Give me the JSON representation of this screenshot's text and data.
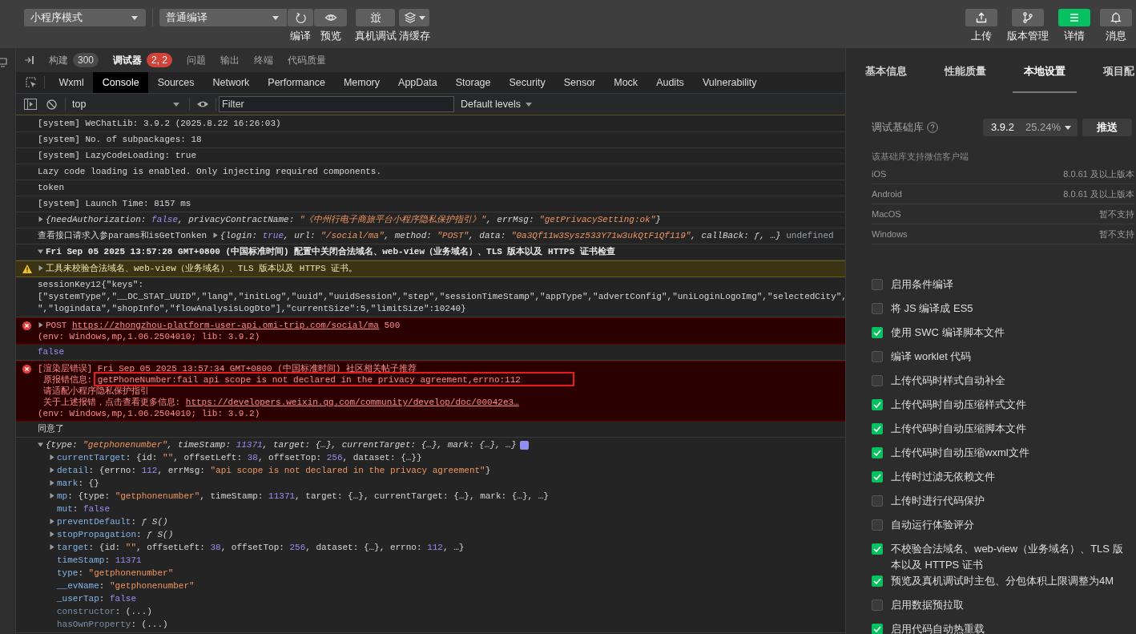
{
  "toolbar": {
    "mode_select": "小程序模式",
    "compile_select": "普通编译",
    "tools": [
      {
        "label": "编译"
      },
      {
        "label": "预览"
      },
      {
        "label": "真机调试"
      },
      {
        "label": "清缓存"
      }
    ],
    "actions": [
      {
        "label": "上传",
        "selected": false
      },
      {
        "label": "版本管理",
        "selected": false
      },
      {
        "label": "详情",
        "selected": true
      },
      {
        "label": "消息",
        "selected": false
      }
    ]
  },
  "panel_tabs": [
    {
      "label": "构建",
      "badge": "300",
      "color": "#4a4a4a",
      "selected": false
    },
    {
      "label": "调试器",
      "badge": "2, 2",
      "color": "#d0423a",
      "selected": true
    },
    {
      "label": "问题",
      "selected": false
    },
    {
      "label": "输出",
      "selected": false
    },
    {
      "label": "终端",
      "selected": false
    },
    {
      "label": "代码质量",
      "selected": false
    }
  ],
  "devtools_tabs": [
    {
      "label": "Wxml",
      "selected": false
    },
    {
      "label": "Console",
      "selected": true
    },
    {
      "label": "Sources",
      "selected": false
    },
    {
      "label": "Network",
      "selected": false
    },
    {
      "label": "Performance",
      "selected": false
    },
    {
      "label": "Memory",
      "selected": false
    },
    {
      "label": "AppData",
      "selected": false
    },
    {
      "label": "Storage",
      "selected": false
    },
    {
      "label": "Security",
      "selected": false
    },
    {
      "label": "Sensor",
      "selected": false
    },
    {
      "label": "Mock",
      "selected": false
    },
    {
      "label": "Audits",
      "selected": false
    },
    {
      "label": "Vulnerability",
      "selected": false
    }
  ],
  "console_toolbar": {
    "context": "top",
    "filter_placeholder": "Filter",
    "levels": "Default levels"
  },
  "console": [
    {
      "kind": "info",
      "lines": [
        [
          {
            "kind": "plain",
            "text": "[system] WeChatLib: 3.9.2 (2025.8.22 16:26:03)"
          }
        ]
      ]
    },
    {
      "kind": "info",
      "lines": [
        [
          {
            "kind": "plain",
            "text": "[system] No. of subpackages: 18"
          }
        ]
      ]
    },
    {
      "kind": "info",
      "lines": [
        [
          {
            "kind": "plain",
            "text": "[system] LazyCodeLoading: true"
          }
        ]
      ]
    },
    {
      "kind": "info",
      "lines": [
        [
          {
            "kind": "plain",
            "text": "Lazy code loading is enabled. Only injecting required components."
          }
        ]
      ]
    },
    {
      "kind": "info",
      "lines": [
        [
          {
            "kind": "plain",
            "text": "token"
          }
        ]
      ]
    },
    {
      "kind": "info",
      "lines": [
        [
          {
            "kind": "plain",
            "text": "[system] Launch Time: 8157 ms"
          }
        ]
      ]
    },
    {
      "kind": "info",
      "lines": [
        [
          {
            "kind": "toggle",
            "expanded": false
          },
          {
            "kind": "preview",
            "text": "{needAuthorization: "
          },
          {
            "kind": "preview_keyword",
            "text": "false"
          },
          {
            "kind": "preview",
            "text": ", privacyContractName: "
          },
          {
            "kind": "preview_string",
            "text": "\"《中州行电子商旅平台小程序隐私保护指引》\""
          },
          {
            "kind": "preview",
            "text": ", errMsg: "
          },
          {
            "kind": "preview_string",
            "text": "\"getPrivacySetting:ok\""
          },
          {
            "kind": "preview",
            "text": "}"
          }
        ]
      ]
    },
    {
      "kind": "info",
      "lines": [
        [
          {
            "kind": "plain",
            "text": "查看接口请求入参params和isGetTonken "
          },
          {
            "kind": "toggle",
            "expanded": false
          },
          {
            "kind": "preview",
            "text": "{login: "
          },
          {
            "kind": "preview_keyword",
            "text": "true"
          },
          {
            "kind": "preview",
            "text": ", url: "
          },
          {
            "kind": "preview_string",
            "text": "\"/social/ma\""
          },
          {
            "kind": "preview",
            "text": ", method: "
          },
          {
            "kind": "preview_string",
            "text": "\"POST\""
          },
          {
            "kind": "preview",
            "text": ", data: "
          },
          {
            "kind": "preview_string",
            "text": "\"0a3Qf11w3Sysz533Y71w3ukQtF1Qf119\""
          },
          {
            "kind": "preview",
            "text": ", callBack: ƒ, …}"
          },
          {
            "kind": "muted",
            "text": " undefined"
          }
        ]
      ]
    },
    {
      "kind": "group",
      "lines": [
        [
          {
            "kind": "toggle",
            "expanded": true
          },
          {
            "kind": "plain",
            "text": "Fri Sep 05 2025 13:57:28 GMT+0800 (中国标准时间) 配置中关闭合法域名、web-view（业务域名）、TLS 版本以及 HTTPS 证书检查"
          }
        ]
      ]
    },
    {
      "kind": "warning",
      "lines": [
        [
          {
            "kind": "toggle",
            "expanded": false
          },
          {
            "kind": "plain",
            "text": "工具未校验合法域名、web-view（业务域名）、TLS 版本以及 HTTPS 证书。"
          }
        ]
      ]
    },
    {
      "kind": "info",
      "lines": [
        [
          {
            "kind": "plain",
            "text": "sessionKey12{\"keys\":"
          }
        ],
        [
          {
            "kind": "plain",
            "text": "[\"systemType\",\"__DC_STAT_UUID\",\"lang\",\"initLog\",\"uuid\",\"uuidSession\",\"step\",\"sessionTimeStamp\",\"appType\",\"advertConfig\",\"uniLoginLogoImg\",\"selectedCity\","
          }
        ],
        [
          {
            "kind": "plain",
            "text": "\",\"logindata\",\"shopInfo\",\"flowAnalysisLogDto\"],\"currentSize\":5,\"limitSize\":10240}"
          }
        ]
      ]
    },
    {
      "kind": "error",
      "lines": [
        [
          {
            "kind": "toggle",
            "expanded": false
          },
          {
            "kind": "plain",
            "text": "POST "
          },
          {
            "kind": "link",
            "text": "https://zhongzhou-platform-user-api.omi-trip.com/social/ma"
          },
          {
            "kind": "plain",
            "text": " 500"
          }
        ],
        [
          {
            "kind": "plain",
            "text": "(env: Windows,mp,1.06.2504010; lib: 3.9.2)"
          }
        ]
      ]
    },
    {
      "kind": "info",
      "lines": [
        [
          {
            "kind": "keyword",
            "text": "false"
          }
        ]
      ]
    },
    {
      "kind": "error",
      "lines": [
        [
          {
            "kind": "plain",
            "text": "[渲染层错误] Fri Sep 05 2025 13:57:34 GMT+0800 (中国标准时间) 社区相关帖子推荐"
          }
        ],
        [
          {
            "kind": "plain",
            "text": " 原报错信息: "
          },
          {
            "kind": "annotated",
            "text": "getPhoneNumber:fail api scope is not declared in the privacy agreement,errno:112"
          }
        ],
        [
          {
            "kind": "plain",
            "text": " 请适配小程序隐私保护指引"
          }
        ],
        [
          {
            "kind": "plain",
            "text": " 关于上述报错，点击查看更多信息: "
          },
          {
            "kind": "link",
            "text": "https://developers.weixin.qq.com/community/develop/doc/00042e3…"
          }
        ],
        [
          {
            "kind": "plain",
            "text": "(env: Windows,mp,1.06.2504010; lib: 3.9.2)"
          }
        ]
      ]
    },
    {
      "kind": "info",
      "lines": [
        [
          {
            "kind": "plain",
            "text": "同意了"
          }
        ]
      ]
    },
    {
      "kind": "info",
      "lines": [
        [
          {
            "kind": "toggle",
            "expanded": true
          },
          {
            "kind": "preview",
            "text": "{type: "
          },
          {
            "kind": "preview_string",
            "text": "\"getphonenumber\""
          },
          {
            "kind": "preview",
            "text": ", timeStamp: "
          },
          {
            "kind": "preview_number",
            "text": "11371"
          },
          {
            "kind": "preview",
            "text": ", target: {…}, currentTarget: {…}, mark: {…}, …}"
          },
          {
            "kind": "info_badge"
          }
        ]
      ],
      "children": [
        {
          "parts": [
            {
              "kind": "toggle",
              "expanded": false
            },
            {
              "kind": "key",
              "text": "currentTarget"
            },
            {
              "kind": "plain",
              "text": ": {id: "
            },
            {
              "kind": "string",
              "text": "\"\""
            },
            {
              "kind": "plain",
              "text": ", offsetLeft: "
            },
            {
              "kind": "number",
              "text": "38"
            },
            {
              "kind": "plain",
              "text": ", offsetTop: "
            },
            {
              "kind": "number",
              "text": "256"
            },
            {
              "kind": "plain",
              "text": ", dataset: {…}}"
            }
          ]
        },
        {
          "parts": [
            {
              "kind": "toggle",
              "expanded": false
            },
            {
              "kind": "key",
              "text": "detail"
            },
            {
              "kind": "plain",
              "text": ": {errno: "
            },
            {
              "kind": "number",
              "text": "112"
            },
            {
              "kind": "plain",
              "text": ", errMsg: "
            },
            {
              "kind": "string",
              "text": "\"api scope is not declared in the privacy agreement\""
            },
            {
              "kind": "plain",
              "text": "}"
            }
          ]
        },
        {
          "parts": [
            {
              "kind": "toggle",
              "expanded": false
            },
            {
              "kind": "key",
              "text": "mark"
            },
            {
              "kind": "plain",
              "text": ": {}"
            }
          ]
        },
        {
          "parts": [
            {
              "kind": "toggle",
              "expanded": false
            },
            {
              "kind": "key",
              "text": "mp"
            },
            {
              "kind": "plain",
              "text": ": {type: "
            },
            {
              "kind": "string",
              "text": "\"getphonenumber\""
            },
            {
              "kind": "plain",
              "text": ", timeStamp: "
            },
            {
              "kind": "number",
              "text": "11371"
            },
            {
              "kind": "plain",
              "text": ", target: {…}, currentTarget: {…}, mark: {…}, …}"
            }
          ]
        },
        {
          "parts": [
            {
              "kind": "key",
              "text": "mut"
            },
            {
              "kind": "plain",
              "text": ": "
            },
            {
              "kind": "keyword",
              "text": "false"
            }
          ]
        },
        {
          "parts": [
            {
              "kind": "toggle",
              "expanded": false
            },
            {
              "kind": "key",
              "text": "preventDefault"
            },
            {
              "kind": "plain",
              "text": ": "
            },
            {
              "kind": "function",
              "text": "ƒ S()"
            }
          ]
        },
        {
          "parts": [
            {
              "kind": "toggle",
              "expanded": false
            },
            {
              "kind": "key",
              "text": "stopPropagation"
            },
            {
              "kind": "plain",
              "text": ": "
            },
            {
              "kind": "function",
              "text": "ƒ S()"
            }
          ]
        },
        {
          "parts": [
            {
              "kind": "toggle",
              "expanded": false
            },
            {
              "kind": "key",
              "text": "target"
            },
            {
              "kind": "plain",
              "text": ": {id: "
            },
            {
              "kind": "string",
              "text": "\"\""
            },
            {
              "kind": "plain",
              "text": ", offsetLeft: "
            },
            {
              "kind": "number",
              "text": "38"
            },
            {
              "kind": "plain",
              "text": ", offsetTop: "
            },
            {
              "kind": "number",
              "text": "256"
            },
            {
              "kind": "plain",
              "text": ", dataset: {…}, errno: "
            },
            {
              "kind": "number",
              "text": "112"
            },
            {
              "kind": "plain",
              "text": ", …}"
            }
          ]
        },
        {
          "parts": [
            {
              "kind": "key",
              "text": "timeStamp"
            },
            {
              "kind": "plain",
              "text": ": "
            },
            {
              "kind": "number",
              "text": "11371"
            }
          ]
        },
        {
          "parts": [
            {
              "kind": "key",
              "text": "type"
            },
            {
              "kind": "plain",
              "text": ": "
            },
            {
              "kind": "string",
              "text": "\"getphonenumber\""
            }
          ]
        },
        {
          "parts": [
            {
              "kind": "key",
              "text": "__evName"
            },
            {
              "kind": "plain",
              "text": ": "
            },
            {
              "kind": "string",
              "text": "\"getphonenumber\""
            }
          ]
        },
        {
          "parts": [
            {
              "kind": "key",
              "text": "_userTap"
            },
            {
              "kind": "plain",
              "text": ": "
            },
            {
              "kind": "keyword",
              "text": "false"
            }
          ]
        },
        {
          "parts": [
            {
              "kind": "proto_key",
              "text": "constructor"
            },
            {
              "kind": "plain",
              "text": ": (...)"
            }
          ]
        },
        {
          "parts": [
            {
              "kind": "proto_key",
              "text": "hasOwnProperty"
            },
            {
              "kind": "plain",
              "text": ": (...)"
            }
          ]
        }
      ]
    }
  ],
  "details_tabs": [
    {
      "label": "基本信息",
      "selected": false
    },
    {
      "label": "性能质量",
      "selected": false
    },
    {
      "label": "本地设置",
      "selected": true
    },
    {
      "label": "项目配",
      "selected": false
    }
  ],
  "settings": {
    "library_label": "调试基础库",
    "library_version": "3.9.2",
    "library_share": "25.24%",
    "push_button": "推送",
    "support_heading": "该基础库支持微信客户端",
    "clients": [
      {
        "platform": "iOS",
        "version": "8.0.61 及以上版本"
      },
      {
        "platform": "Android",
        "version": "8.0.61 及以上版本"
      },
      {
        "platform": "MacOS",
        "version": "暂不支持"
      },
      {
        "platform": "Windows",
        "version": "暂不支持"
      }
    ],
    "options": [
      {
        "label": "启用条件编译",
        "checked": false
      },
      {
        "label": "将 JS 编译成 ES5",
        "checked": false
      },
      {
        "label": "使用 SWC 编译脚本文件",
        "checked": true
      },
      {
        "label": "编译 worklet 代码",
        "checked": false
      },
      {
        "label": "上传代码时样式自动补全",
        "checked": false
      },
      {
        "label": "上传代码时自动压缩样式文件",
        "checked": true
      },
      {
        "label": "上传代码时自动压缩脚本文件",
        "checked": true
      },
      {
        "label": "上传代码时自动压缩wxml文件",
        "checked": true
      },
      {
        "label": "上传时过滤无依赖文件",
        "checked": true
      },
      {
        "label": "上传时进行代码保护",
        "checked": false
      },
      {
        "label": "自动运行体验评分",
        "checked": false
      },
      {
        "label": "不校验合法域名、web-view（业务域名）、TLS 版本以及 HTTPS 证书",
        "checked": true
      },
      {
        "label": "预览及真机调试时主包、分包体积上限调整为4M",
        "checked": true
      },
      {
        "label": "启用数据预拉取",
        "checked": false
      },
      {
        "label": "启用代码自动热重载",
        "checked": true
      }
    ]
  }
}
